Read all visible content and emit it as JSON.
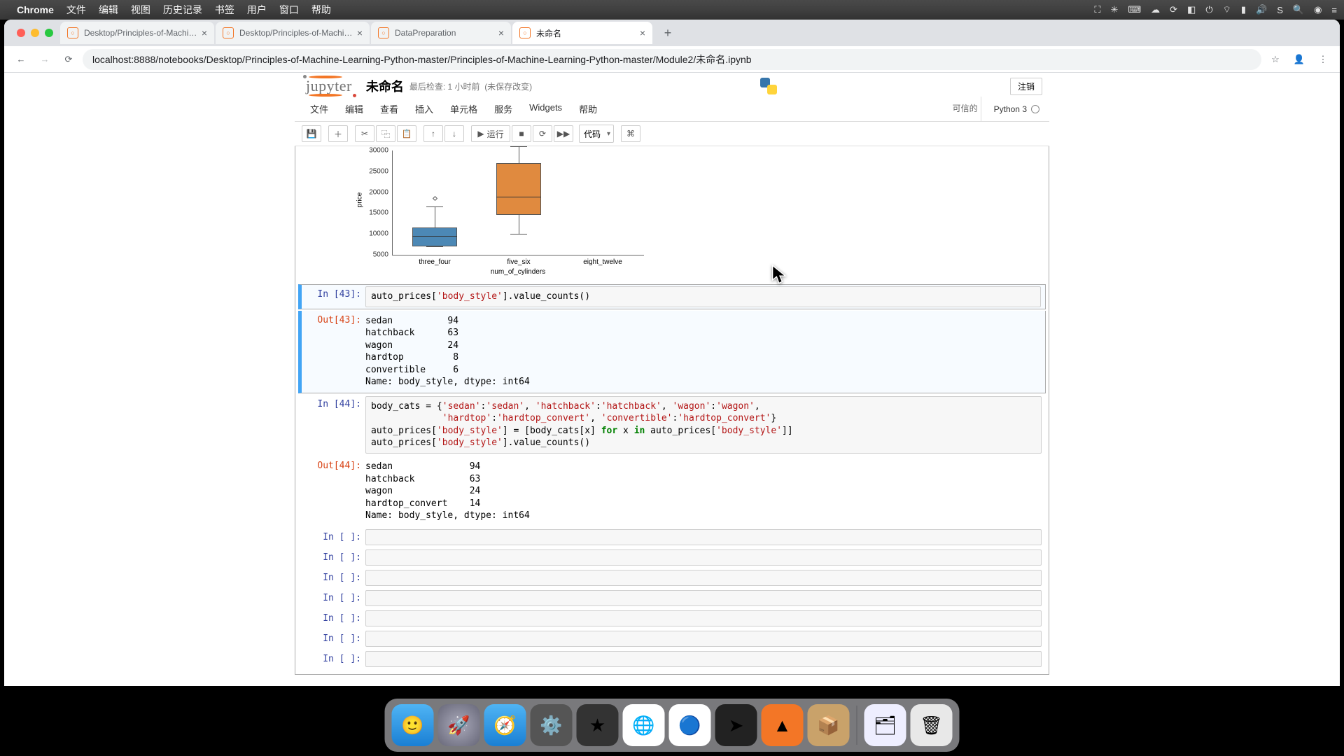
{
  "menubar": {
    "app": "Chrome",
    "items": [
      "文件",
      "编辑",
      "视图",
      "历史记录",
      "书签",
      "用户",
      "窗口",
      "帮助"
    ]
  },
  "tabs": [
    {
      "title": "Desktop/Principles-of-Machine",
      "fav": "jup"
    },
    {
      "title": "Desktop/Principles-of-Machine",
      "fav": "jup"
    },
    {
      "title": "DataPreparation",
      "fav": "jup"
    },
    {
      "title": "未命名",
      "fav": "jup",
      "active": true
    }
  ],
  "url": "localhost:8888/notebooks/Desktop/Principles-of-Machine-Learning-Python-master/Principles-of-Machine-Learning-Python-master/Module2/未命名.ipynb",
  "jupyter": {
    "logo": "jupyter",
    "title": "未命名",
    "checkpoint": "最后检查: 1 小时前",
    "autosave": "(未保存改变)",
    "logout": "注销",
    "menus": [
      "文件",
      "编辑",
      "查看",
      "插入",
      "单元格",
      "服务",
      "Widgets",
      "帮助"
    ],
    "trusted": "可信的",
    "kernel": "Python 3",
    "toolbar": {
      "run": "运行",
      "celltype": "代码"
    }
  },
  "chart_data": {
    "type": "boxplot",
    "ylabel": "price",
    "xlabel": "num_of_cylinders",
    "yticks": [
      5000,
      10000,
      15000,
      20000,
      25000,
      30000
    ],
    "categories": [
      "three_four",
      "five_six",
      "eight_twelve"
    ],
    "series": [
      {
        "name": "three_four",
        "q1": 7000,
        "median": 9000,
        "q3": 11500,
        "low": 5000,
        "high": 16500,
        "outliers": [
          19000
        ]
      },
      {
        "name": "five_six",
        "q1": 14500,
        "median": 19000,
        "q3": 27000,
        "low": 10000,
        "high": 31000
      },
      {
        "name": "eight_twelve",
        "q1": null,
        "note": "off-visible"
      }
    ]
  },
  "cells": [
    {
      "in_n": "43",
      "prompt_in": "In [43]:",
      "prompt_out": "Out[43]:",
      "code": "auto_prices['body_style'].value_counts()",
      "out": "sedan          94\nhatchback      63\nwagon          24\nhardtop         8\nconvertible     6\nName: body_style, dtype: int64",
      "selected": true
    },
    {
      "in_n": "44",
      "prompt_in": "In [44]:",
      "prompt_out": "Out[44]:",
      "code": "body_cats = {'sedan':'sedan', 'hatchback':'hatchback', 'wagon':'wagon',\n             'hardtop':'hardtop_convert', 'convertible':'hardtop_convert'}\nauto_prices['body_style'] = [body_cats[x] for x in auto_prices['body_style']]\nauto_prices['body_style'].value_counts()",
      "out": "sedan              94\nhatchback          63\nwagon              24\nhardtop_convert    14\nName: body_style, dtype: int64"
    }
  ],
  "empty_prompt": "In [ ]:",
  "empty_count": 7,
  "dock": [
    "Finder",
    "Launchpad",
    "Safari",
    "Settings",
    "iMovie",
    "Chrome",
    "Baidu",
    "Terminal",
    "VLC",
    "Archive",
    "|",
    "Desktop",
    "Trash"
  ]
}
